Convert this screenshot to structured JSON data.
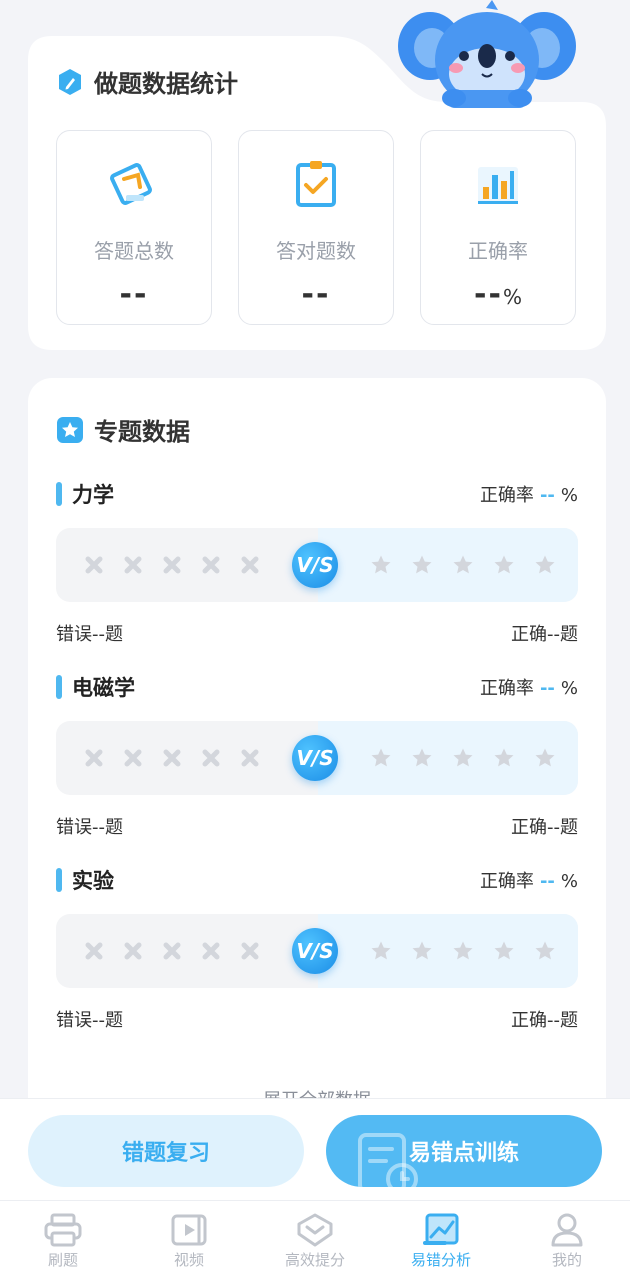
{
  "stats": {
    "title": "做题数据统计",
    "items": [
      {
        "label": "答题总数",
        "value": "--",
        "unit": ""
      },
      {
        "label": "答对题数",
        "value": "--",
        "unit": ""
      },
      {
        "label": "正确率",
        "value": "--",
        "unit": "%"
      }
    ]
  },
  "topics": {
    "title": "专题数据",
    "vs_label": "V/S",
    "items": [
      {
        "name": "力学",
        "accuracy_label": "正确率",
        "accuracy_value": "--",
        "accuracy_unit": "%",
        "wrong": "错误--题",
        "right": "正确--题"
      },
      {
        "name": "电磁学",
        "accuracy_label": "正确率",
        "accuracy_value": "--",
        "accuracy_unit": "%",
        "wrong": "错误--题",
        "right": "正确--题"
      },
      {
        "name": "实验",
        "accuracy_label": "正确率",
        "accuracy_value": "--",
        "accuracy_unit": "%",
        "wrong": "错误--题",
        "right": "正确--题"
      }
    ],
    "expand_label": "展开全部数据"
  },
  "actions": {
    "review_label": "错题复习",
    "train_label": "易错点训练"
  },
  "nav": {
    "items": [
      {
        "label": "刷题",
        "icon": "printer-icon"
      },
      {
        "label": "视频",
        "icon": "video-icon"
      },
      {
        "label": "高效提分",
        "icon": "chevron-badge-icon"
      },
      {
        "label": "易错分析",
        "icon": "chart-icon",
        "active": true
      },
      {
        "label": "我的",
        "icon": "user-icon"
      }
    ]
  },
  "colors": {
    "accent": "#4fb8f0",
    "accent_dark": "#1b8de6",
    "cross_mark": "#d3d6dc",
    "star_mark": "#d3d6dc"
  }
}
